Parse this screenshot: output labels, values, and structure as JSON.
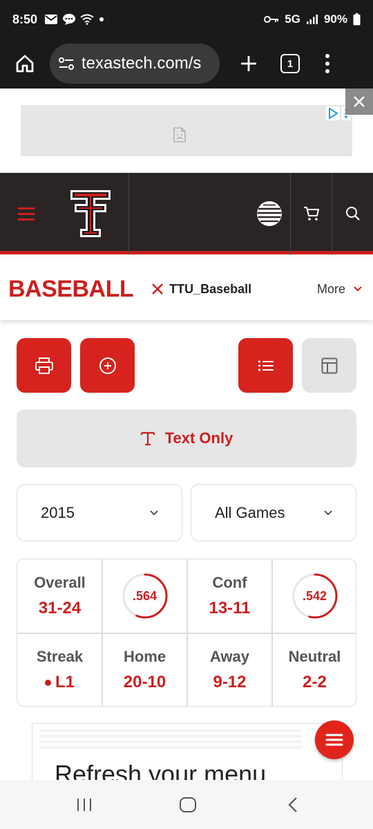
{
  "status_bar": {
    "time": "8:50",
    "network": "5G",
    "battery": "90%",
    "icons": [
      "mail-icon",
      "chat-icon",
      "wifi-icon",
      "dot-icon",
      "key-icon",
      "signal-icon",
      "battery-icon"
    ]
  },
  "browser": {
    "url": "texastech.com/s",
    "tab_count": "1",
    "icons": [
      "home-icon",
      "site-settings-icon",
      "plus-icon",
      "tabs-icon",
      "more-vert-icon"
    ]
  },
  "header": {
    "icons": [
      "hamburger-icon",
      "double-t-logo",
      "att-logo",
      "cart-icon",
      "search-icon"
    ],
    "accent_color": "#cc1f1f",
    "background_color": "#2a2524"
  },
  "subnav": {
    "sport": "BASEBALL",
    "twitter_handle": "TTU_Baseball",
    "more_label": "More"
  },
  "toolbar": {
    "icons": [
      "print-icon",
      "plus-circle-icon",
      "list-view-icon",
      "table-view-icon"
    ]
  },
  "text_only": {
    "label": "Text Only"
  },
  "filters": {
    "season": "2015",
    "games": "All Games"
  },
  "record": {
    "overall": {
      "label": "Overall",
      "value": "31-24"
    },
    "overall_pct": {
      "value": ".564",
      "fraction": 0.564
    },
    "conf": {
      "label": "Conf",
      "value": "13-11"
    },
    "conf_pct": {
      "value": ".542",
      "fraction": 0.542
    },
    "streak": {
      "label": "Streak",
      "value": "L1"
    },
    "home": {
      "label": "Home",
      "value": "20-10"
    },
    "away": {
      "label": "Away",
      "value": "9-12"
    },
    "neutral": {
      "label": "Neutral",
      "value": "2-2"
    }
  },
  "bottom_ad": {
    "headline": "Refresh your menu"
  }
}
